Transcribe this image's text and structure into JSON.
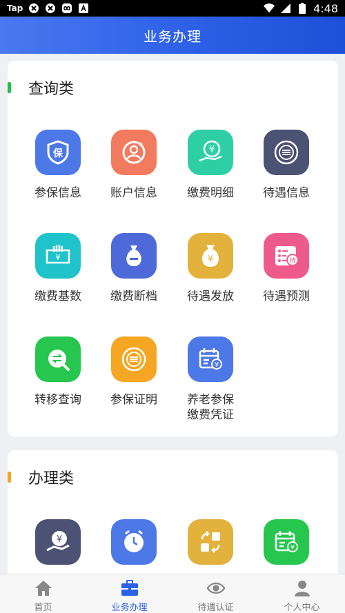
{
  "status_bar": {
    "left_text": "Tap",
    "time": "4:48"
  },
  "header": {
    "title": "业务办理"
  },
  "query_section": {
    "title": "查询类",
    "accent": "#22c14b",
    "items": [
      {
        "label": "参保信息",
        "icon": "shield-bao-icon",
        "color": "#4d78e8"
      },
      {
        "label": "账户信息",
        "icon": "user-refresh-icon",
        "color": "#f27a5e"
      },
      {
        "label": "缴费明细",
        "icon": "yuan-hand-icon",
        "color": "#2fcfa6"
      },
      {
        "label": "待遇信息",
        "icon": "coin-stack-icon",
        "color": "#4b5274"
      },
      {
        "label": "缴费基数",
        "icon": "cash-hand-icon",
        "color": "#1fc3c9"
      },
      {
        "label": "缴费断档",
        "icon": "bag-minus-icon",
        "color": "#4e6ad8"
      },
      {
        "label": "待遇发放",
        "icon": "money-bag-icon",
        "color": "#e2b23c"
      },
      {
        "label": "待遇预测",
        "icon": "list-dai-icon",
        "color": "#ee5b8a"
      },
      {
        "label": "转移查询",
        "icon": "transfer-search-icon",
        "color": "#27c64f"
      },
      {
        "label": "参保证明",
        "icon": "coin-circle-icon",
        "color": "#f5a623"
      },
      {
        "label_line1": "养老参保",
        "label_line2": "缴费凭证",
        "icon": "calendar-yuan-icon",
        "color": "#4d78e8"
      }
    ]
  },
  "handle_section": {
    "title": "办理类",
    "accent": "#f5a623",
    "items": [
      {
        "icon": "yuan-hand-icon",
        "color": "#4b5274"
      },
      {
        "icon": "clock-icon",
        "color": "#4d78e8"
      },
      {
        "icon": "grid-arrows-icon",
        "color": "#e2b23c"
      },
      {
        "icon": "calendar-yuan-icon",
        "color": "#27c64f"
      }
    ]
  },
  "tabbar": {
    "tabs": [
      {
        "label": "首页",
        "icon": "home-icon"
      },
      {
        "label": "业务办理",
        "icon": "briefcase-icon",
        "active": true
      },
      {
        "label": "待遇认证",
        "icon": "eye-icon"
      },
      {
        "label": "个人中心",
        "icon": "person-icon"
      }
    ]
  }
}
